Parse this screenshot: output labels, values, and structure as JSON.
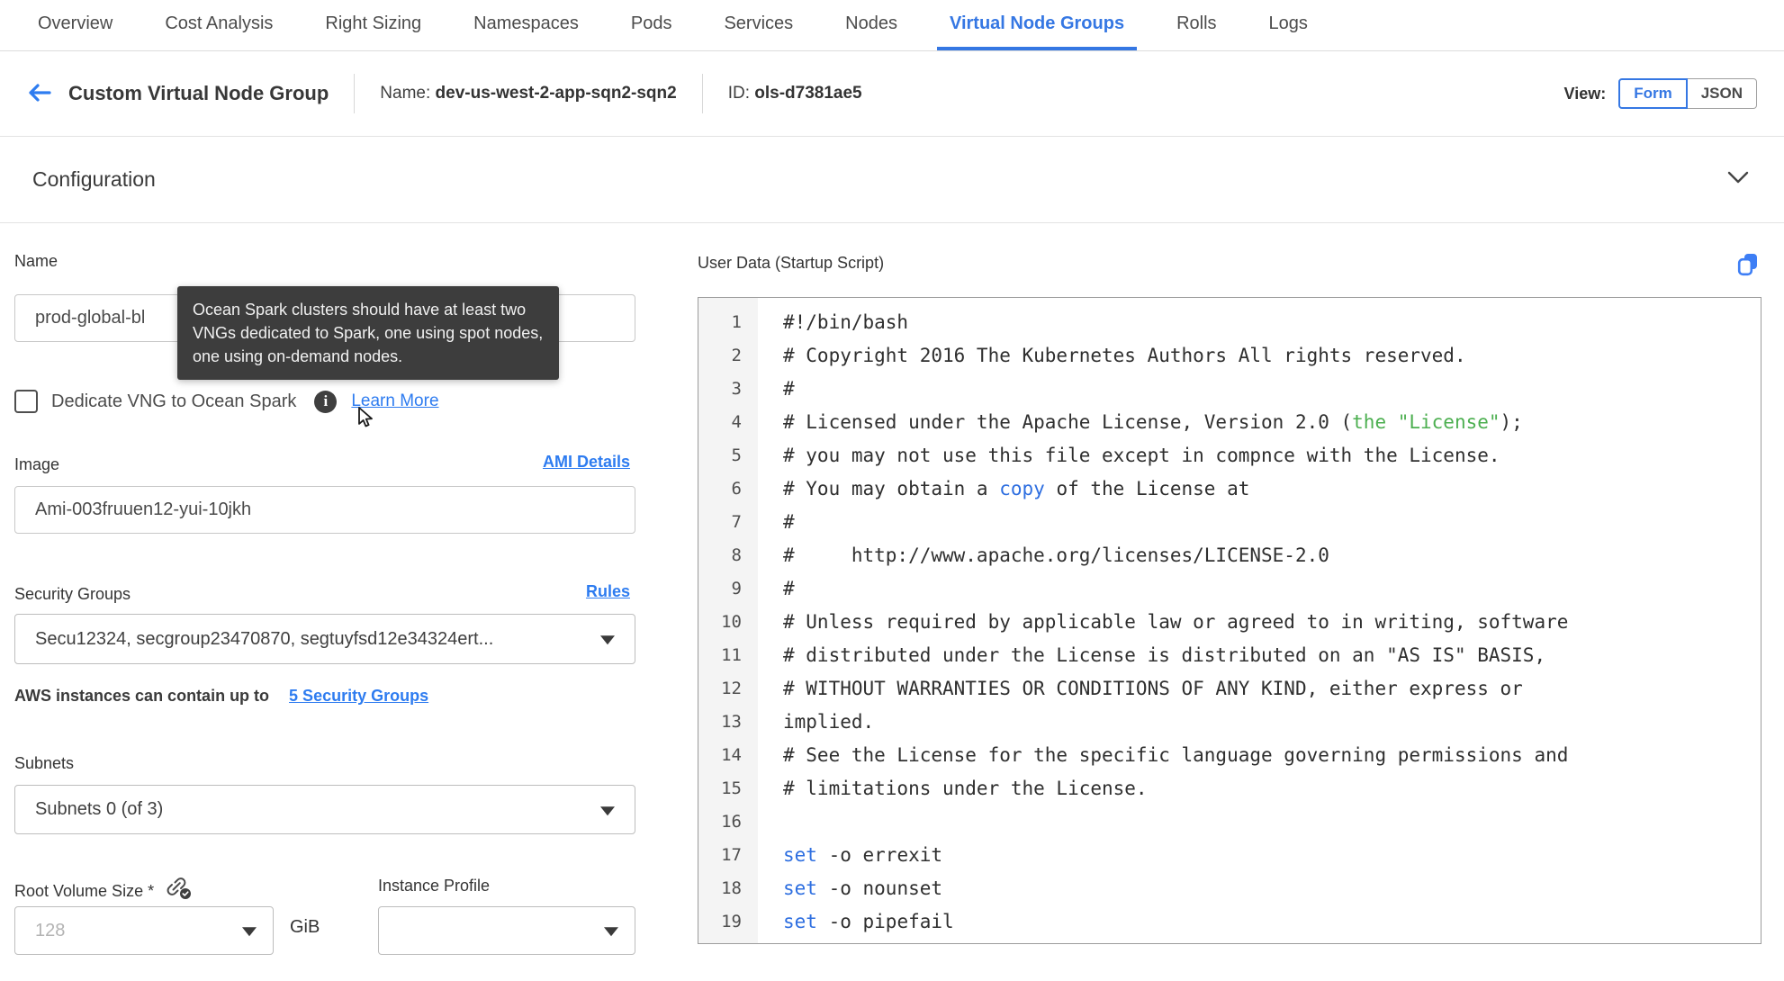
{
  "colors": {
    "accent": "#3577e3",
    "link": "#2e7cf0",
    "code_green": "#4caf50",
    "code_blue": "#2d6ee0",
    "tooltip_bg": "#3d3d3d"
  },
  "tabs": {
    "items": [
      {
        "label": "Overview",
        "active": false
      },
      {
        "label": "Cost Analysis",
        "active": false
      },
      {
        "label": "Right Sizing",
        "active": false
      },
      {
        "label": "Namespaces",
        "active": false
      },
      {
        "label": "Pods",
        "active": false
      },
      {
        "label": "Services",
        "active": false
      },
      {
        "label": "Nodes",
        "active": false
      },
      {
        "label": "Virtual Node Groups",
        "active": true
      },
      {
        "label": "Rolls",
        "active": false
      },
      {
        "label": "Logs",
        "active": false
      }
    ]
  },
  "header": {
    "title": "Custom Virtual Node Group",
    "name_label": "Name:",
    "name_value": "dev-us-west-2-app-sqn2-sqn2",
    "id_label": "ID:",
    "id_value": "ols-d7381ae5",
    "view": {
      "label": "View:",
      "options": [
        {
          "label": "Form",
          "selected": true
        },
        {
          "label": "JSON",
          "selected": false
        }
      ]
    }
  },
  "configuration": {
    "title": "Configuration"
  },
  "form": {
    "name": {
      "label": "Name",
      "value": "prod-global-bl"
    },
    "tooltip": {
      "text": "Ocean Spark clusters should have at least two VNGs dedicated to Spark, one using spot nodes, one using on-demand nodes."
    },
    "spark": {
      "checkbox_label": "Dedicate VNG to Ocean Spark",
      "learn_more": "Learn More"
    },
    "image": {
      "label": "Image",
      "link": "AMI Details",
      "value": "Ami-003fruuen12-yui-10jkh"
    },
    "security_groups": {
      "label": "Security Groups",
      "link": "Rules",
      "value": "Secu12324, secgroup23470870, segtuyfsd12e34324ert...",
      "note": "AWS instances can contain up to",
      "note_link": "5 Security Groups"
    },
    "subnets": {
      "label": "Subnets",
      "value": "Subnets 0 (of 3)"
    },
    "root_volume": {
      "label": "Root Volume Size *",
      "placeholder": "128",
      "unit": "GiB"
    },
    "instance_profile": {
      "label": "Instance Profile",
      "value": ""
    }
  },
  "editor": {
    "title": "User Data (Startup Script)",
    "lines": [
      [
        [
          "#!/bin/bash",
          "d"
        ]
      ],
      [
        [
          "# Copyright 2016 The Kubernetes Authors All rights reserved.",
          "d"
        ]
      ],
      [
        [
          "#",
          "d"
        ]
      ],
      [
        [
          "# Licensed under the Apache License, Version 2.0 (",
          "d"
        ],
        [
          "the \"License\"",
          "g"
        ],
        [
          ");",
          "d"
        ]
      ],
      [
        [
          "# you may not use this file except in compnce with the License.",
          "d"
        ]
      ],
      [
        [
          "# You may obtain a ",
          "d"
        ],
        [
          "copy",
          "b"
        ],
        [
          " of the License at",
          "d"
        ]
      ],
      [
        [
          "#",
          "d"
        ]
      ],
      [
        [
          "#     http://www.apache.org/licenses/LICENSE-2.0",
          "d"
        ]
      ],
      [
        [
          "#",
          "d"
        ]
      ],
      [
        [
          "# Unless required by applicable law or agreed to in writing, software",
          "d"
        ]
      ],
      [
        [
          "# distributed under the License is distributed on an \"AS IS\" BASIS,",
          "d"
        ]
      ],
      [
        [
          "# WITHOUT WARRANTIES OR CONDITIONS OF ANY KIND, either express or",
          "d"
        ]
      ],
      [
        [
          "implied.",
          "d"
        ]
      ],
      [
        [
          "# See the License for the specific language governing permissions and",
          "d"
        ]
      ],
      [
        [
          "# limitations under the License.",
          "d"
        ]
      ],
      [
        [
          "",
          "d"
        ]
      ],
      [
        [
          "set",
          "b"
        ],
        [
          " -o errexit",
          "d"
        ]
      ],
      [
        [
          "set",
          "b"
        ],
        [
          " -o nounset",
          "d"
        ]
      ],
      [
        [
          "set",
          "b"
        ],
        [
          " -o pipefail",
          "d"
        ]
      ]
    ]
  }
}
